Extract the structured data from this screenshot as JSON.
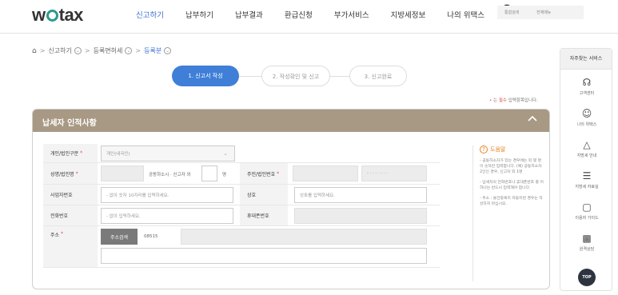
{
  "header": {
    "logo": "wetax",
    "nav": [
      "신고하기",
      "납부하기",
      "납부결과",
      "환급신청",
      "부가서비스",
      "지방세정보",
      "나의 위택스"
    ],
    "search": {
      "icon": "search-icon",
      "label": "통합검색"
    },
    "menu": {
      "icon": "menu-icon",
      "label": "전체메뉴"
    }
  },
  "breadcrumb": [
    "신고하기",
    "등록면허세",
    "등록분"
  ],
  "steps": [
    "1. 신고서 작성",
    "2. 작성확인 및 신고",
    "3. 신고완료"
  ],
  "required_note": {
    "prefix": "•",
    "star": "는",
    "required_word": "필수",
    "suffix": "입력항목입니다."
  },
  "panel": {
    "title": "납세자 인적사항",
    "collapse_icon": "chevron-up-icon"
  },
  "form": {
    "type_label": "개인/법인구분",
    "type_value": "개인(내국인)",
    "name_label": "성명/법인명",
    "co_owner_text": "공동하소시 · 신고자 외",
    "co_owner_unit": "명",
    "rrn_label": "주민/법인번호",
    "rrn_masked": "- · · · · · · ·",
    "bizno_label": "사업자번호",
    "bizno_placeholder": "- 없이 숫자 10자리를 입력하세요.",
    "trade_label": "상호",
    "trade_placeholder": "상호를 입력하세요.",
    "phone_label": "전화번호",
    "phone_placeholder": "- 없이 입력하세요.",
    "mobile_label": "휴대폰번호",
    "address_label": "주소",
    "address_button": "주소검색",
    "zipcode": "08515"
  },
  "help": {
    "title": "도움말",
    "items": [
      "- 공동하소자가 있는 경우에는 외 몇 명 이 숫자만 입력합니다. (예) 공동하소자 2인인 경우, 신고자 외 1명",
      "- 납세자의 전화번호나 휴대폰번호 중 어 하나는 반드시 입력해야 합니다.",
      "- 주소 : 물건등록지 자동지번 경우는 작성하지 마십시오."
    ]
  },
  "sidebar": {
    "title": "자주찾는 서비스",
    "items": [
      {
        "label": "고객센터",
        "icon": "headset-icon"
      },
      {
        "label": "나의 위택스",
        "icon": "user-icon"
      },
      {
        "label": "지방세 안내",
        "icon": "tax-bag-icon"
      },
      {
        "label": "지방세 자료실",
        "icon": "list-icon"
      },
      {
        "label": "이용자 가이드",
        "icon": "guide-icon"
      },
      {
        "label": "원격상담",
        "icon": "remote-support-icon"
      }
    ],
    "top_button": "TOP"
  }
}
